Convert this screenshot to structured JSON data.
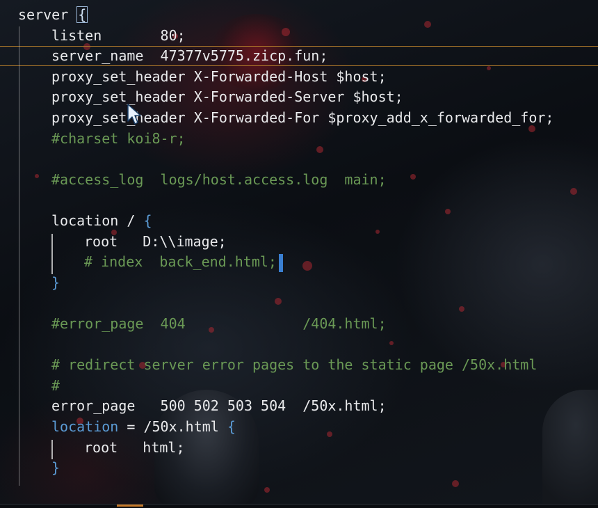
{
  "editor": {
    "language": "nginx",
    "lines": [
      {
        "indent": 0,
        "tokens": [
          {
            "t": "server ",
            "c": "kw"
          },
          {
            "t": "{",
            "c": "cursor"
          }
        ]
      },
      {
        "indent": 1,
        "tokens": [
          {
            "t": "listen       80;",
            "c": "kw"
          }
        ]
      },
      {
        "indent": 1,
        "tokens": [
          {
            "t": "server_name  47377v5775.zicp.fun;",
            "c": "kw"
          }
        ]
      },
      {
        "indent": 1,
        "tokens": [
          {
            "t": "proxy_set_header X-Forwarded-Host $host;",
            "c": "kw"
          }
        ]
      },
      {
        "indent": 1,
        "tokens": [
          {
            "t": "proxy_set_header X-Forwarded-Server $host;",
            "c": "kw"
          }
        ]
      },
      {
        "indent": 1,
        "tokens": [
          {
            "t": "proxy_set_header X-Forwarded-For $proxy_add_x_forwarded_for;",
            "c": "kw"
          }
        ]
      },
      {
        "indent": 1,
        "tokens": [
          {
            "t": "#charset koi8-r;",
            "c": "cm"
          }
        ]
      },
      {
        "indent": 1,
        "tokens": []
      },
      {
        "indent": 1,
        "tokens": [
          {
            "t": "#access_log  logs/host.access.log  main;",
            "c": "cm"
          }
        ]
      },
      {
        "indent": 1,
        "tokens": []
      },
      {
        "indent": 1,
        "tokens": [
          {
            "t": "location / ",
            "c": "kw"
          },
          {
            "t": "{",
            "c": "brace"
          }
        ]
      },
      {
        "indent": 2,
        "tokens": [
          {
            "t": "root   D:\\\\image;",
            "c": "kw"
          }
        ]
      },
      {
        "indent": 2,
        "tokens": [
          {
            "t": "# index  back_end.html;",
            "c": "cm"
          },
          {
            "t": "",
            "c": "caret"
          }
        ]
      },
      {
        "indent": 1,
        "tokens": [
          {
            "t": "}",
            "c": "brace"
          }
        ]
      },
      {
        "indent": 1,
        "tokens": []
      },
      {
        "indent": 1,
        "tokens": [
          {
            "t": "#error_page  404              /404.html;",
            "c": "cm"
          }
        ]
      },
      {
        "indent": 1,
        "tokens": []
      },
      {
        "indent": 1,
        "tokens": [
          {
            "t": "# redirect server error pages to the static page /50x.html",
            "c": "cm"
          }
        ]
      },
      {
        "indent": 1,
        "tokens": [
          {
            "t": "#",
            "c": "cm"
          }
        ]
      },
      {
        "indent": 1,
        "tokens": [
          {
            "t": "error_page   500 502 503 504  /50x.html;",
            "c": "kw"
          }
        ]
      },
      {
        "indent": 1,
        "tokens": [
          {
            "t": "location",
            "c": "blue"
          },
          {
            "t": " = /50x.html ",
            "c": "kw"
          },
          {
            "t": "{",
            "c": "brace"
          }
        ]
      },
      {
        "indent": 2,
        "tokens": [
          {
            "t": "root   html;",
            "c": "kw"
          }
        ]
      },
      {
        "indent": 1,
        "tokens": [
          {
            "t": "}",
            "c": "brace"
          }
        ]
      }
    ]
  },
  "icons": {
    "mouse_pointer": "mouse-pointer-icon"
  },
  "colors": {
    "text": "#e6e6e6",
    "comment": "#6a9955",
    "keyword_blue": "#5b9bd5",
    "current_line_border": "#b07a2a",
    "caret": "#3a7fd1"
  }
}
